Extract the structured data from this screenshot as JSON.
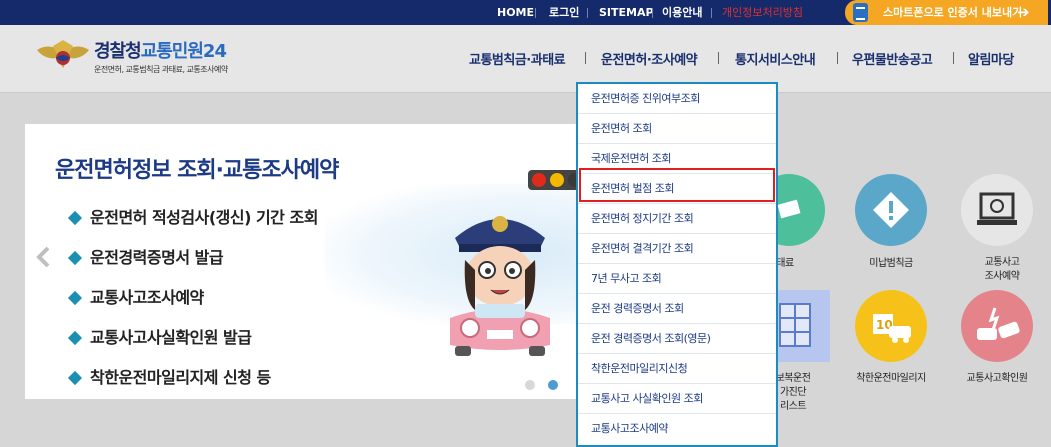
{
  "topbar": {
    "links": [
      "HOME",
      "로그인",
      "SITEMAP",
      "이용안내",
      "개인정보처리방침"
    ],
    "smart_login": "스마트폰으로 인증서 내보내기",
    "smart_arrow": "➔"
  },
  "logo": {
    "title_main": "경찰청",
    "title_accent": "교통민원24",
    "subtitle": "운전면허, 교통범칙금 과태료, 교통조사예약"
  },
  "gnb": [
    "교통범칙금·과태료",
    "운전면허·조사예약",
    "통지서비스안내",
    "우편물반송공고",
    "알림마당"
  ],
  "hero": {
    "title": "운전면허정보 조회·교통조사예약",
    "items": [
      "운전면허 적성검사(갱신) 기간 조회",
      "운전경력증명서 발급",
      "교통사고조사예약",
      "교통사고사실확인원 발급",
      "착한운전마일리지제 신청 등"
    ],
    "prev_arrow": "‹"
  },
  "dropdown": {
    "items": [
      "운전면허증 진위여부조회",
      "운전면허 조회",
      "국제운전면허 조회",
      "운전면허 벌점 조회",
      "운전면허 정지기간 조회",
      "운전면허 결격기간 조회",
      "7년 무사고 조회",
      "운전 경력증명서 조회",
      "운전 경력증명서 조회(영문)",
      "착한운전마일리지신청",
      "교통사고 사실확인원 조회",
      "교통사고조사예약"
    ],
    "highlighted_index": 3
  },
  "grid": {
    "labels_row1": [
      "태료",
      "미납범칙금",
      "교통사고\n조사예약"
    ],
    "labels_row2": [
      "보복운전\n가진단\n리스트",
      "착한운전마일리지",
      "교통사고확인원"
    ],
    "icon_text_10": "10"
  },
  "colors": {
    "topbar": "#142a6b",
    "accent_orange": "#f5a623",
    "dropdown_border": "#1c8cc0",
    "highlight_red": "#e02020",
    "green": "#4dbf9a",
    "teal": "#5ba7c9",
    "yellow": "#f6c21a",
    "pink": "#e4848a",
    "purple_blue": "#7b9be0"
  }
}
